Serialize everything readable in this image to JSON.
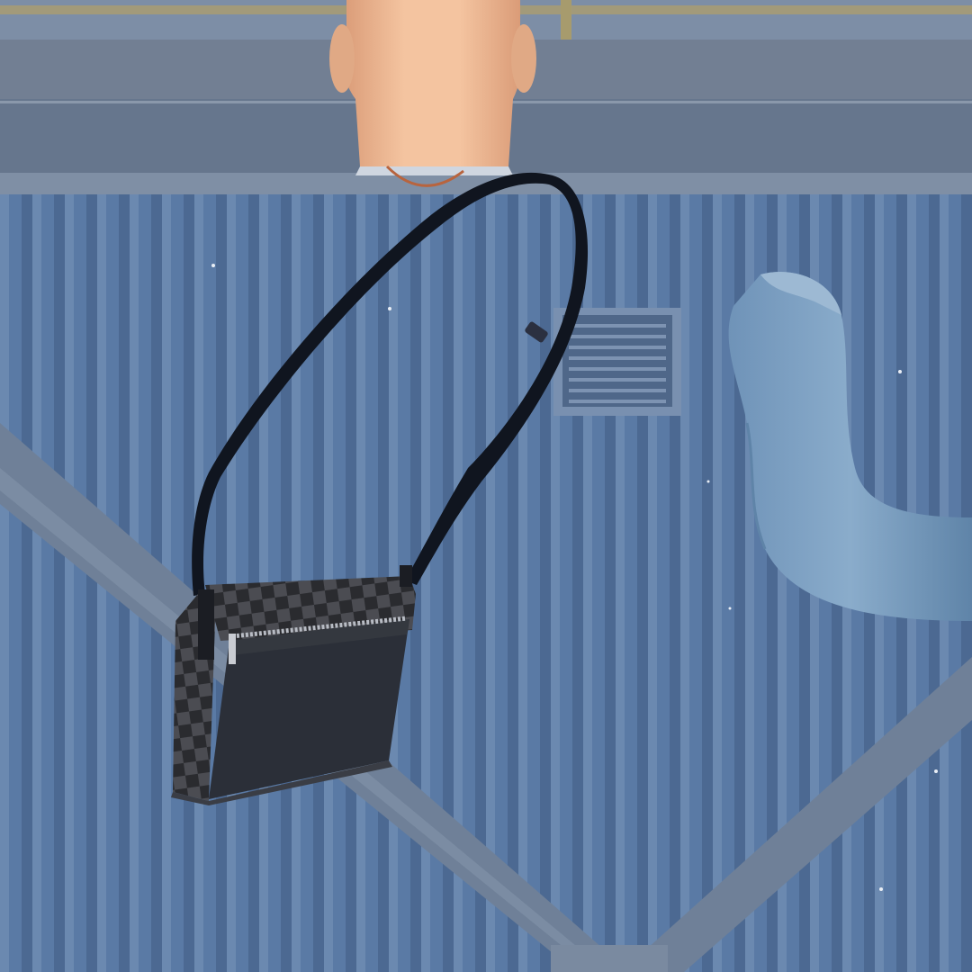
{
  "scene": {
    "view": "clothing-preview",
    "item": "crossbody-messenger-bag",
    "item_pattern": "checkered",
    "character": "bald-head-back-view"
  },
  "colors": {
    "wall": "#5a7aa5",
    "wall_rib_dark": "#4a6690",
    "wall_rib_light": "#6d8ab0",
    "beam": "#6e7f96",
    "beam_dark": "#56667d",
    "strut": "#72839b",
    "duct": "#7ea1c2",
    "duct_shadow": "#5f84a8",
    "vent": "#4d6587",
    "skin": "#f2bf9a",
    "skin_shadow": "#d99a76",
    "strap": "#10151f",
    "bag_flap": "#2b2f38",
    "bag_check_dark": "#2a2b2f",
    "bag_check_light": "#4b4c52",
    "zipper": "#b8bcc4"
  }
}
